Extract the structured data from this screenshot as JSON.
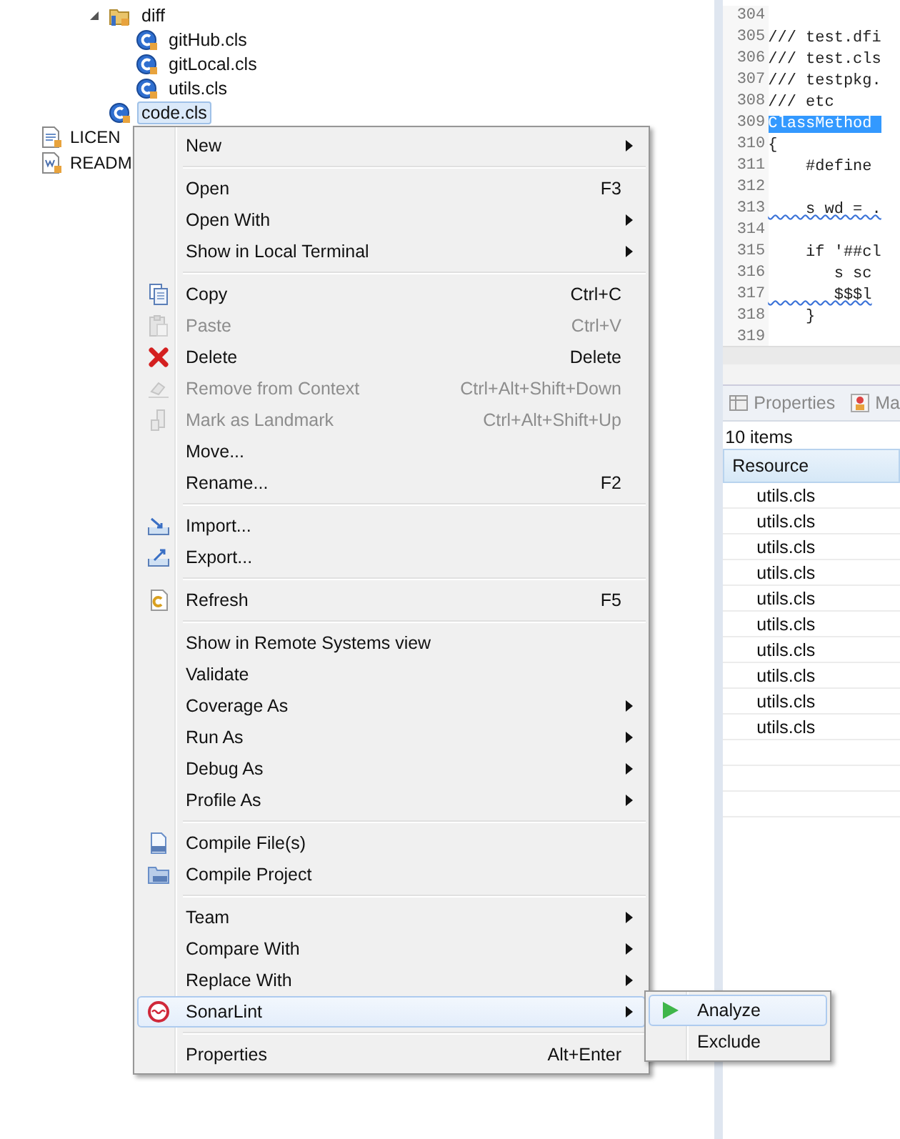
{
  "project_tree": {
    "items": [
      {
        "label": "diff",
        "expanded": true,
        "selected": false,
        "children": [
          {
            "label": "gitHub.cls",
            "selected": false
          },
          {
            "label": "gitLocal.cls",
            "selected": false
          },
          {
            "label": "utils.cls",
            "selected": false
          }
        ]
      },
      {
        "label": "code.cls",
        "selected": true
      },
      {
        "label": "LICEN",
        "selected": false
      },
      {
        "label": "READM",
        "selected": false
      }
    ]
  },
  "editor": {
    "lines": [
      {
        "number": "304"
      },
      {
        "number": "305",
        "code": "/// test.dfi",
        "highlighted": false,
        "squiggle": false
      },
      {
        "number": "306",
        "code": "/// test.cls",
        "highlighted": false,
        "squiggle": false
      },
      {
        "number": "307",
        "code": "/// testpkg.",
        "highlighted": false,
        "squiggle": false
      },
      {
        "number": "308",
        "code": "/// etc",
        "highlighted": false,
        "squiggle": false
      },
      {
        "number": "309",
        "code": "ClassMethod ",
        "highlighted": true,
        "squiggle": false
      },
      {
        "number": "310",
        "code": "{",
        "highlighted": false,
        "squiggle": false
      },
      {
        "number": "311",
        "code": "    #define",
        "highlighted": false,
        "squiggle": false
      },
      {
        "number": "312"
      },
      {
        "number": "313",
        "code": "    s wd = .",
        "highlighted": false,
        "squiggle": true
      },
      {
        "number": "314"
      },
      {
        "number": "315",
        "code": "    if '##cl",
        "highlighted": false,
        "squiggle": false
      },
      {
        "number": "316",
        "code": "       s sc",
        "highlighted": false,
        "squiggle": false
      },
      {
        "number": "317",
        "code": "       $$$l",
        "highlighted": false,
        "squiggle": true
      },
      {
        "number": "318",
        "code": "    }",
        "highlighted": false,
        "squiggle": false
      },
      {
        "number": "319"
      }
    ]
  },
  "properties_view": {
    "tabs": [
      {
        "label": "Properties",
        "selected": false
      },
      {
        "label": "Ma",
        "selected": false
      }
    ],
    "count": "10 items",
    "columns": [
      "Resource"
    ],
    "rows": [
      "utils.cls",
      "utils.cls",
      "utils.cls",
      "utils.cls",
      "utils.cls",
      "utils.cls",
      "utils.cls",
      "utils.cls",
      "utils.cls",
      "utils.cls"
    ]
  },
  "context_menu": {
    "items": [
      {
        "kind": "item",
        "label": "New",
        "submenu": true,
        "disabled": false,
        "selected": false
      },
      {
        "kind": "separator"
      },
      {
        "kind": "item",
        "label": "Open",
        "shortcut": "F3",
        "submenu": false,
        "disabled": false,
        "selected": false
      },
      {
        "kind": "item",
        "label": "Open With",
        "submenu": true,
        "disabled": false,
        "selected": false
      },
      {
        "kind": "item",
        "label": "Show in Local Terminal",
        "submenu": true,
        "disabled": false,
        "selected": false
      },
      {
        "kind": "separator"
      },
      {
        "kind": "item",
        "label": "Copy",
        "shortcut": "Ctrl+C",
        "submenu": false,
        "disabled": false,
        "selected": false
      },
      {
        "kind": "item",
        "label": "Paste",
        "shortcut": "Ctrl+V",
        "submenu": false,
        "disabled": true,
        "selected": false
      },
      {
        "kind": "item",
        "label": "Delete",
        "shortcut": "Delete",
        "submenu": false,
        "disabled": false,
        "selected": false
      },
      {
        "kind": "item",
        "label": "Remove from Context",
        "shortcut": "Ctrl+Alt+Shift+Down",
        "submenu": false,
        "disabled": true,
        "selected": false
      },
      {
        "kind": "item",
        "label": "Mark as Landmark",
        "shortcut": "Ctrl+Alt+Shift+Up",
        "submenu": false,
        "disabled": true,
        "selected": false
      },
      {
        "kind": "item",
        "label": "Move...",
        "submenu": false,
        "disabled": false,
        "selected": false
      },
      {
        "kind": "item",
        "label": "Rename...",
        "shortcut": "F2",
        "submenu": false,
        "disabled": false,
        "selected": false
      },
      {
        "kind": "separator"
      },
      {
        "kind": "item",
        "label": "Import...",
        "submenu": false,
        "disabled": false,
        "selected": false
      },
      {
        "kind": "item",
        "label": "Export...",
        "submenu": false,
        "disabled": false,
        "selected": false
      },
      {
        "kind": "separator"
      },
      {
        "kind": "item",
        "label": "Refresh",
        "shortcut": "F5",
        "submenu": false,
        "disabled": false,
        "selected": false
      },
      {
        "kind": "separator"
      },
      {
        "kind": "item",
        "label": "Show in Remote Systems view",
        "submenu": false,
        "disabled": false,
        "selected": false
      },
      {
        "kind": "item",
        "label": "Validate",
        "submenu": false,
        "disabled": false,
        "selected": false
      },
      {
        "kind": "item",
        "label": "Coverage As",
        "submenu": true,
        "disabled": false,
        "selected": false
      },
      {
        "kind": "item",
        "label": "Run As",
        "submenu": true,
        "disabled": false,
        "selected": false
      },
      {
        "kind": "item",
        "label": "Debug As",
        "submenu": true,
        "disabled": false,
        "selected": false
      },
      {
        "kind": "item",
        "label": "Profile As",
        "submenu": true,
        "disabled": false,
        "selected": false
      },
      {
        "kind": "separator"
      },
      {
        "kind": "item",
        "label": "Compile File(s)",
        "submenu": false,
        "disabled": false,
        "selected": false
      },
      {
        "kind": "item",
        "label": "Compile Project",
        "submenu": false,
        "disabled": false,
        "selected": false
      },
      {
        "kind": "separator"
      },
      {
        "kind": "item",
        "label": "Team",
        "submenu": true,
        "disabled": false,
        "selected": false
      },
      {
        "kind": "item",
        "label": "Compare With",
        "submenu": true,
        "disabled": false,
        "selected": false
      },
      {
        "kind": "item",
        "label": "Replace With",
        "submenu": true,
        "disabled": false,
        "selected": false
      },
      {
        "kind": "item",
        "label": "SonarLint",
        "submenu": true,
        "disabled": false,
        "selected": true
      },
      {
        "kind": "separator"
      },
      {
        "kind": "item",
        "label": "Properties",
        "shortcut": "Alt+Enter",
        "submenu": false,
        "disabled": false,
        "selected": false
      }
    ]
  },
  "submenu": {
    "items": [
      {
        "label": "Analyze",
        "selected": true
      },
      {
        "label": "Exclude",
        "selected": false
      }
    ]
  }
}
